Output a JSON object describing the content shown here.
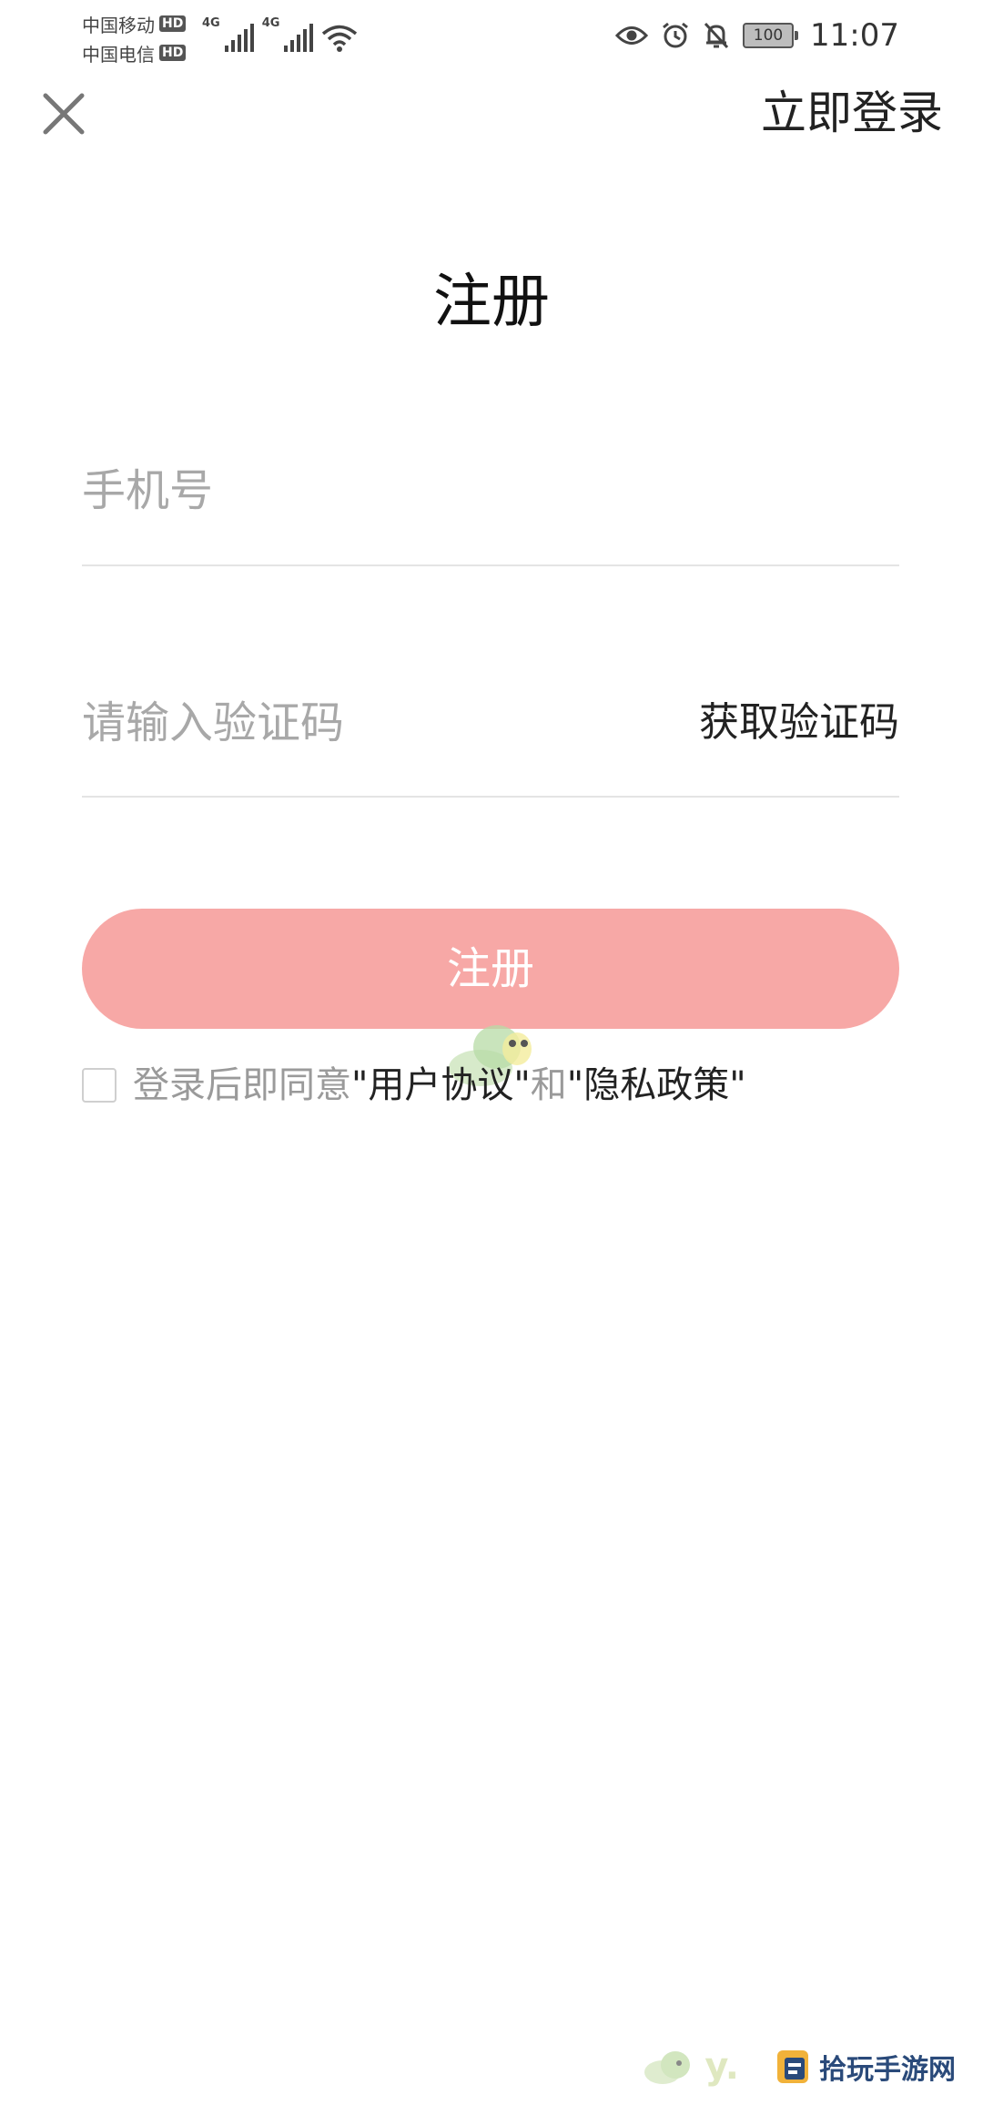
{
  "status_bar": {
    "carrier1": "中国移动",
    "carrier2": "中国电信",
    "hd_label": "HD",
    "network_type": "4G",
    "battery": "100",
    "time": "11:07",
    "icons": [
      "eye-icon",
      "alarm-icon",
      "bell-muted-icon",
      "battery-icon",
      "signal-icon",
      "wifi-icon"
    ]
  },
  "header": {
    "close_icon": "close-icon",
    "login_label": "立即登录"
  },
  "page": {
    "title": "注册"
  },
  "form": {
    "phone_placeholder": "手机号",
    "code_placeholder": "请输入验证码",
    "get_code_label": "获取验证码",
    "submit_label": "注册"
  },
  "agreement": {
    "prefix": "登录后即同意",
    "terms": "\"用户协议\"",
    "and": "和",
    "privacy": "\"隐私政策\""
  },
  "watermark": {
    "text": "拾玩手游网"
  },
  "colors": {
    "accent": "#f7a8a6",
    "placeholder": "#a8a8a8",
    "divider": "#e4e4e4"
  }
}
